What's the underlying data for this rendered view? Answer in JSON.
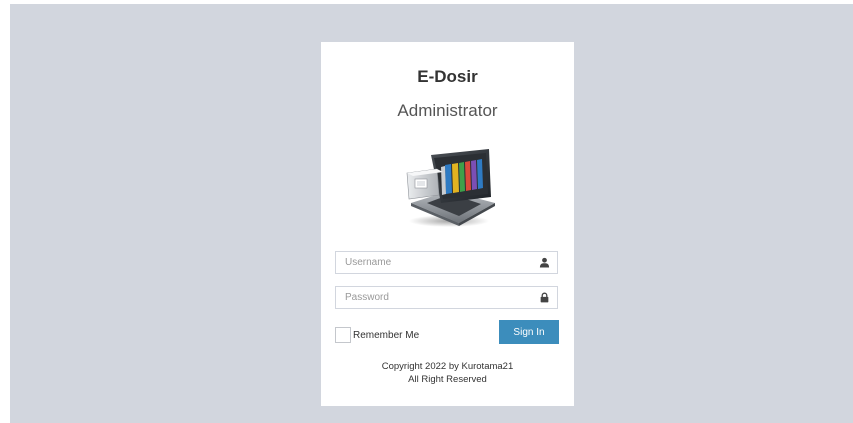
{
  "header": {
    "app_title": "E-Dosir",
    "role_title": "Administrator"
  },
  "logo": {
    "icon": "laptop-file-cabinet-icon"
  },
  "form": {
    "username": {
      "value": "",
      "placeholder": "Username",
      "icon": "user-icon"
    },
    "password": {
      "value": "",
      "placeholder": "Password",
      "icon": "lock-icon"
    },
    "remember_me": {
      "label": "Remember Me",
      "checked": false
    },
    "sign_in_label": "Sign In"
  },
  "footer": {
    "copyright_line1": "Copyright 2022 by Kurotama21",
    "copyright_line2": "All Right Reserved"
  },
  "colors": {
    "page_background": "#d2d6de",
    "card_background": "#ffffff",
    "primary_button": "#3c8dbc"
  }
}
